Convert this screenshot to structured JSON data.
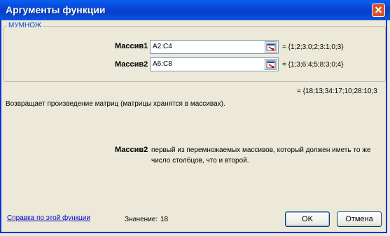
{
  "window": {
    "title": "Аргументы функции"
  },
  "group": {
    "name": "МУМНОЖ"
  },
  "args": [
    {
      "label": "Массив1",
      "value": "A2:C4",
      "result": "= {1;2;3:0;2;3:1;0;3}"
    },
    {
      "label": "Массив2",
      "value": "A6:C8",
      "result": "= {1;3;6:4;5;8:3;0;4}"
    }
  ],
  "overall_result": "= {18;13;34:17;10;28:10;3",
  "description": "Возвращает произведение матриц (матрицы хранятся в массивах).",
  "arg_help": {
    "name": "Массив2",
    "line1": "первый из перемножаемых массивов, который должен иметь то же",
    "line2": "число столбцов, что и второй."
  },
  "footer": {
    "help_link": "Справка по этой функции",
    "value_label": "Значение:",
    "value": "18",
    "ok_label": "OK",
    "cancel_label": "Отмена"
  }
}
